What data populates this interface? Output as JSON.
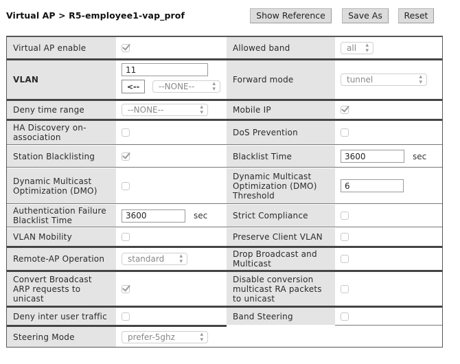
{
  "header": {
    "breadcrumb": "Virtual AP > R5-employee1-vap_prof",
    "buttons": {
      "show_reference": "Show Reference",
      "save_as": "Save As",
      "reset": "Reset"
    }
  },
  "left": {
    "virtual_ap_enable": {
      "label": "Virtual AP enable",
      "checked": true
    },
    "vlan": {
      "label": "VLAN",
      "value": "11",
      "assign_button": "<--",
      "select": "--NONE--"
    },
    "deny_time_range": {
      "label": "Deny time range",
      "select": "--NONE--"
    },
    "ha_discovery": {
      "label": "HA Discovery on-association",
      "checked": false
    },
    "station_blacklisting": {
      "label": "Station Blacklisting",
      "checked": true
    },
    "dmo": {
      "label": "Dynamic Multicast Optimization (DMO)",
      "checked": false
    },
    "auth_failure_blacklist_time": {
      "label": "Authentication Failure Blacklist Time",
      "value": "3600",
      "unit": "sec"
    },
    "vlan_mobility": {
      "label": "VLAN Mobility",
      "checked": false
    },
    "remote_ap_operation": {
      "label": "Remote-AP Operation",
      "select": "standard"
    },
    "convert_broadcast_arp": {
      "label": "Convert Broadcast ARP requests to unicast",
      "checked": true
    },
    "deny_inter_user_traffic": {
      "label": "Deny inter user traffic",
      "checked": false
    },
    "steering_mode": {
      "label": "Steering Mode",
      "select": "prefer-5ghz"
    }
  },
  "right": {
    "allowed_band": {
      "label": "Allowed band",
      "select": "all"
    },
    "forward_mode": {
      "label": "Forward mode",
      "select": "tunnel"
    },
    "mobile_ip": {
      "label": "Mobile IP",
      "checked": true
    },
    "dos_prevention": {
      "label": "DoS Prevention",
      "checked": false
    },
    "blacklist_time": {
      "label": "Blacklist Time",
      "value": "3600",
      "unit": "sec"
    },
    "dmo_threshold": {
      "label": "Dynamic Multicast Optimization (DMO) Threshold",
      "value": "6"
    },
    "strict_compliance": {
      "label": "Strict Compliance",
      "checked": false
    },
    "preserve_client_vlan": {
      "label": "Preserve Client VLAN",
      "checked": false
    },
    "drop_broadcast_multicast": {
      "label": "Drop Broadcast and Multicast",
      "checked": false
    },
    "disable_conversion_multicast_ra": {
      "label": "Disable conversion multicast RA packets to unicast",
      "checked": false
    },
    "band_steering": {
      "label": "Band Steering",
      "checked": false
    }
  }
}
